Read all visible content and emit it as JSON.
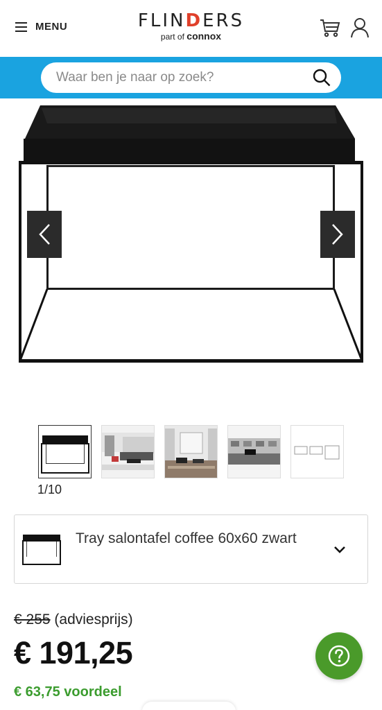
{
  "header": {
    "menu_label": "MENU",
    "logo_main_prefix": "FLIN",
    "logo_main_d": "D",
    "logo_main_suffix": "ERS",
    "logo_sub_prefix": "part of ",
    "logo_sub_brand": "connox",
    "icons": {
      "menu": "hamburger-icon",
      "cart": "cart-icon",
      "account": "user-icon"
    }
  },
  "search": {
    "placeholder": "Waar ben je naar op zoek?",
    "value": "",
    "bar_color": "#1aa3e0"
  },
  "gallery": {
    "counter": "1/10",
    "current": 1,
    "total": 10,
    "thumbnails": [
      "tray-table-front",
      "living-room-scene",
      "window-room-scene",
      "showroom-scene",
      "tray-table-sizes"
    ]
  },
  "variant": {
    "label": "Tray salontafel coffee 60x60 zwart"
  },
  "pricing": {
    "old_price": "€ 255",
    "old_price_note": "(adviesprijs)",
    "price": "€ 191,25",
    "saving": "€ 63,75 voordeel",
    "saving_color": "#3b9c2e"
  },
  "help": {
    "icon": "question-icon",
    "color": "#4a9a2a"
  }
}
